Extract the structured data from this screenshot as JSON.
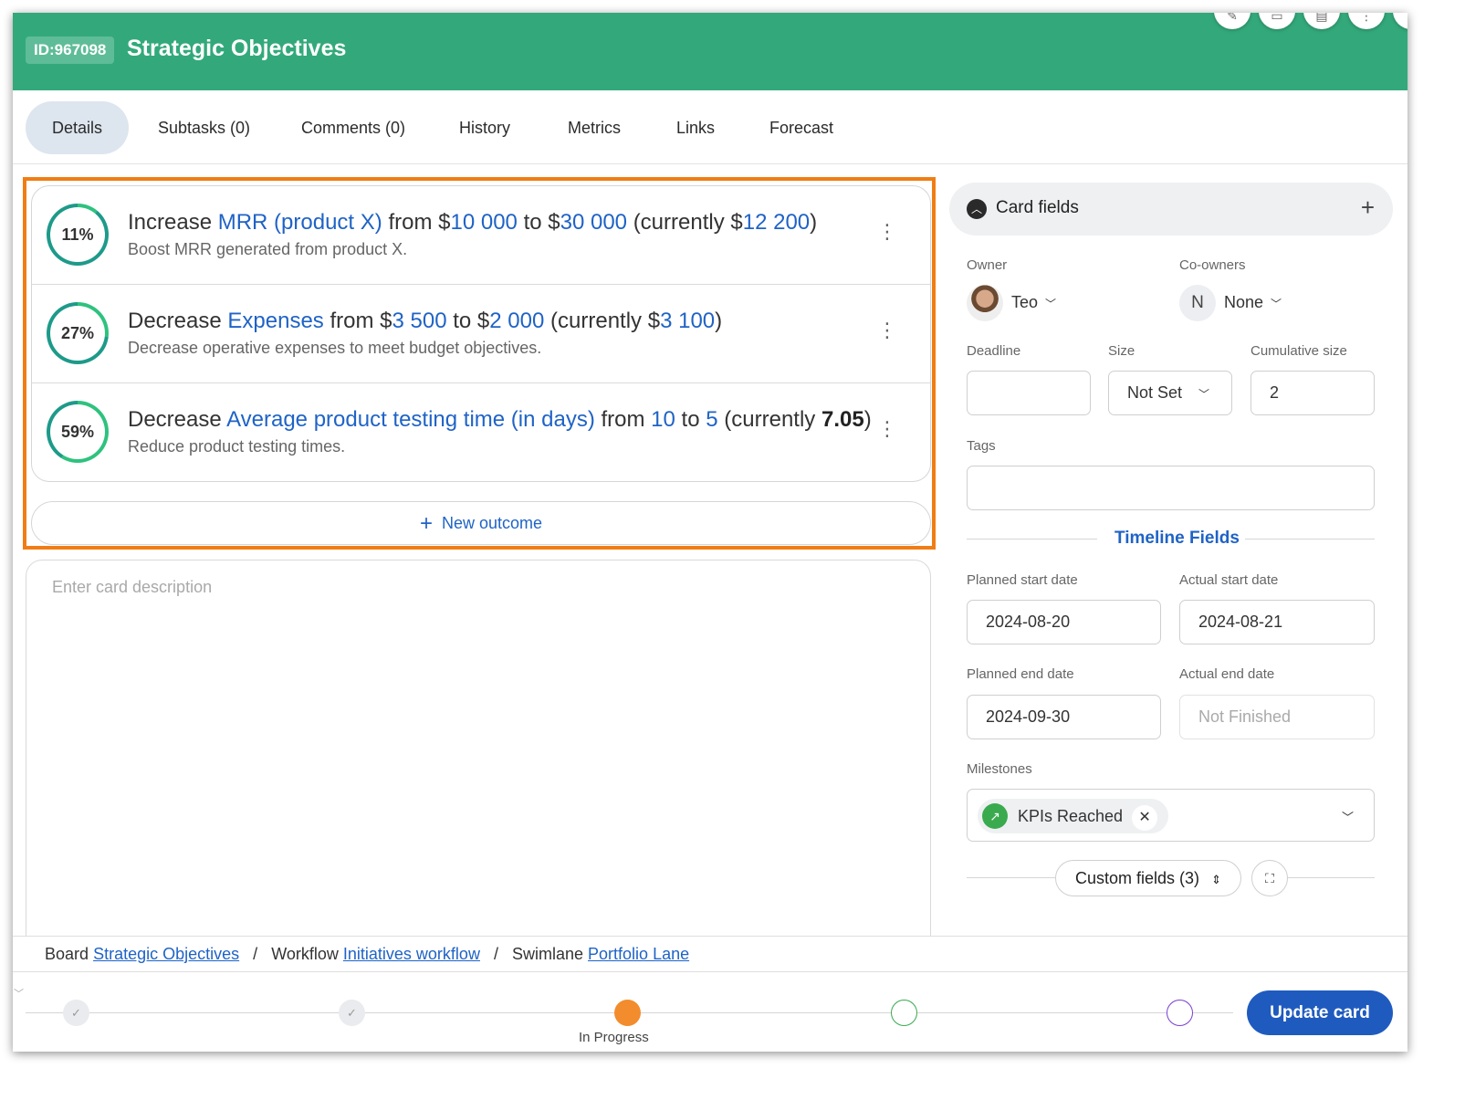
{
  "header": {
    "id_badge": "ID:967098",
    "title": "Strategic Objectives",
    "bg_color": "#33a97b"
  },
  "tabs": [
    {
      "label": "Details",
      "active": true
    },
    {
      "label": "Subtasks (0)",
      "active": false
    },
    {
      "label": "Comments (0)",
      "active": false
    },
    {
      "label": "History",
      "active": false
    },
    {
      "label": "Metrics",
      "active": false
    },
    {
      "label": "Links",
      "active": false
    },
    {
      "label": "Forecast",
      "active": false
    }
  ],
  "outcomes": [
    {
      "percent": "11%",
      "progress": 0.11,
      "verb": "Increase",
      "metric": "MRR (product X)",
      "from_word": "from",
      "from_prefix": "$",
      "from_value": "10 000",
      "to_word": "to",
      "to_prefix": "$",
      "to_value": "30 000",
      "current_word": "(currently",
      "current_prefix": "$",
      "current_value": "12 200",
      "close": ")",
      "description": "Boost MRR generated from product X."
    },
    {
      "percent": "27%",
      "progress": 0.27,
      "verb": "Decrease",
      "metric": "Expenses",
      "from_word": "from",
      "from_prefix": "$",
      "from_value": "3 500",
      "to_word": "to",
      "to_prefix": "$",
      "to_value": "2 000",
      "current_word": "(currently",
      "current_prefix": "$",
      "current_value": "3 100",
      "close": ")",
      "description": "Decrease operative expenses to meet budget objectives."
    },
    {
      "percent": "59%",
      "progress": 0.59,
      "verb": "Decrease",
      "metric": "Average product testing time (in days)",
      "from_word": "from",
      "from_prefix": "",
      "from_value": "10",
      "to_word": "to",
      "to_prefix": "",
      "to_value": "5",
      "current_word": "(currently",
      "current_prefix": "",
      "current_value": "7.05",
      "close": ")",
      "description": "Reduce product testing times."
    }
  ],
  "new_outcome_label": "New outcome",
  "description_placeholder": "Enter card description",
  "card_fields": {
    "title": "Card fields",
    "owner_label": "Owner",
    "owner_name": "Teo",
    "coowners_label": "Co-owners",
    "coowner_initial": "N",
    "coowner_value": "None",
    "deadline_label": "Deadline",
    "deadline_value": "",
    "size_label": "Size",
    "size_value": "Not Set",
    "cumulative_label": "Cumulative size",
    "cumulative_value": "2",
    "tags_label": "Tags",
    "timeline_title": "Timeline Fields",
    "planned_start_label": "Planned start date",
    "planned_start_value": "2024-08-20",
    "actual_start_label": "Actual start date",
    "actual_start_value": "2024-08-21",
    "planned_end_label": "Planned end date",
    "planned_end_value": "2024-09-30",
    "actual_end_label": "Actual end date",
    "actual_end_value": "Not Finished",
    "milestones_label": "Milestones",
    "milestone_chip": "KPIs Reached",
    "custom_fields_label": "Custom fields (3)"
  },
  "breadcrumb": {
    "board_label": "Board",
    "board_link": "Strategic Objectives",
    "workflow_label": "Workflow",
    "workflow_link": "Initiatives workflow",
    "swimlane_label": "Swimlane",
    "swimlane_link": "Portfolio Lane",
    "separator": "/"
  },
  "progress_steps": {
    "current_label": "In Progress"
  },
  "update_button": "Update card",
  "colors": {
    "accent_blue": "#1f63c6",
    "highlight_orange": "#f07d14",
    "ring_green": "#2ec27e",
    "ring_teal": "#1d9a8a",
    "step_current": "#f28c2c",
    "step_green": "#3aaa4f",
    "step_purple": "#7a3fd1"
  }
}
